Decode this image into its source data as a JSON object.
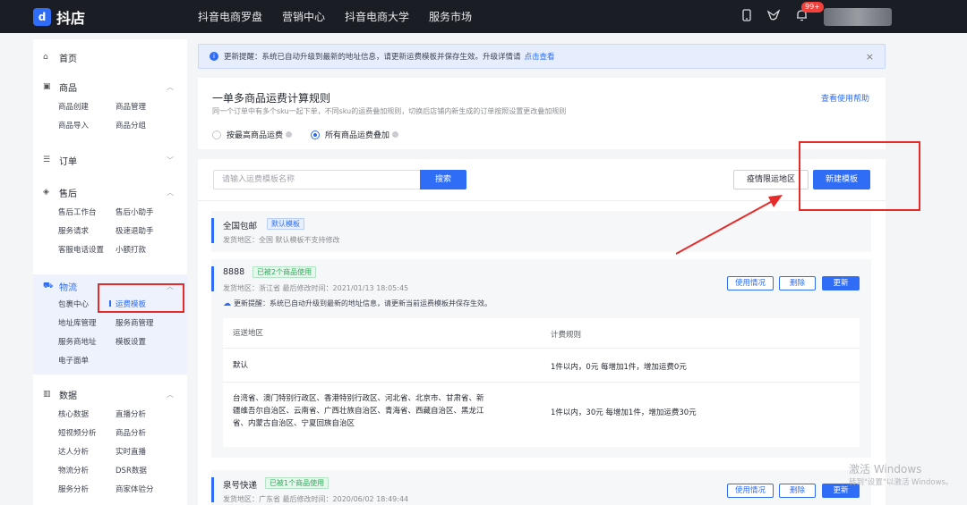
{
  "topbar": {
    "logo_text": "抖店",
    "nav": [
      "抖音电商罗盘",
      "营销中心",
      "抖音电商大学",
      "服务市场"
    ],
    "badge": "99+"
  },
  "sidebar": {
    "home": "首页",
    "goods": {
      "title": "商品",
      "items": [
        "商品创建",
        "商品管理",
        "商品导入",
        "商品分组"
      ]
    },
    "orders": {
      "title": "订单"
    },
    "aftersale": {
      "title": "售后",
      "items": [
        "售后工作台",
        "售后小助手",
        "服务请求",
        "极速退助手",
        "客服电话设置",
        "小额打款"
      ]
    },
    "logistics": {
      "title": "物流",
      "items": [
        "包裹中心",
        "运费模板",
        "地址库管理",
        "服务商管理",
        "服务商地址",
        "模板设置",
        "电子面单"
      ]
    },
    "data": {
      "title": "数据",
      "items": [
        "核心数据",
        "直播分析",
        "短视频分析",
        "商品分析",
        "达人分析",
        "实时直播",
        "物流分析",
        "DSR数据",
        "服务分析",
        "商家体验分"
      ]
    }
  },
  "notice": {
    "text": "更新提醒：系统已自动升级到最新的地址信息，请更新运费模板并保存生效。升级详情请",
    "link": "点击查看",
    "close": "×"
  },
  "rule_card": {
    "title": "一单多商品运费计算规则",
    "desc": "同一个订单中有多个sku一起下单，不同sku的运费叠加规则，切换后店铺内新生成的订单按照设置更改叠加规则",
    "help": "查看使用帮助",
    "option1": "按最高商品运费",
    "option2": "所有商品运费叠加",
    "selected": 2
  },
  "toolbar": {
    "search_placeholder": "请输入运费模板名称",
    "search_btn": "搜索",
    "epidemic_btn": "疫情限运地区",
    "new_btn": "新建模板"
  },
  "templates": [
    {
      "name": "全国包邮",
      "tag": "默认模板",
      "meta": "发货地区：全国    默认模板不支持修改"
    },
    {
      "name": "8888",
      "tag": "已被2个商品使用",
      "meta": "发货地区：浙江省    最后修改时间：2021/01/13 18:05:45",
      "warn": "更新提醒：系统已自动升级到最新的地址信息，请更新当前运费模板并保存生效。",
      "actions": [
        "使用情况",
        "删除",
        "更新"
      ],
      "table": {
        "headers": [
          "运送地区",
          "计费规则"
        ],
        "rows": [
          {
            "region": "默认",
            "rule": "1件以内，0元    每增加1件，增加运费0元"
          },
          {
            "region_lines": [
              "台湾省、澳门特别行政区、香港特别行政区、河北省、北京市、甘肃省、新",
              "疆维吾尔自治区、云南省、广西壮族自治区、青海省、西藏自治区、黑龙江",
              "省、内蒙古自治区、宁夏回族自治区"
            ],
            "rule": "1件以内，30元    每增加1件，增加运费30元"
          }
        ]
      }
    },
    {
      "name": "泉号快递",
      "tag": "已被1个商品使用",
      "meta": "发货地区：广东省    最后修改时间：2020/06/02 18:49:44",
      "actions": [
        "使用情况",
        "删除",
        "更新"
      ]
    }
  ],
  "watermark": {
    "line1": "激活 Windows",
    "line2": "转到\"设置\"以激活 Windows。"
  }
}
